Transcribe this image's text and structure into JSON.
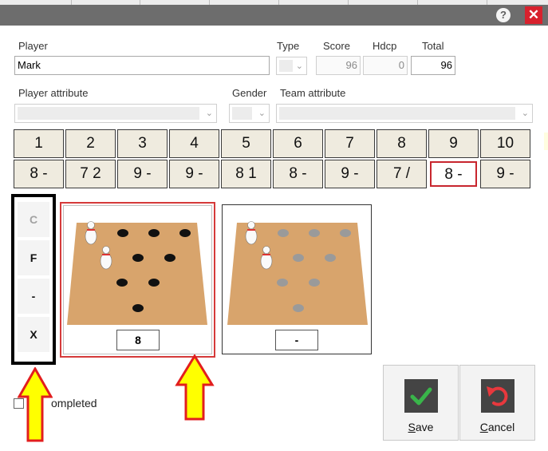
{
  "window": {
    "help_glyph": "?",
    "close_glyph": "✕"
  },
  "form": {
    "player_label": "Player",
    "player_value": "Mark",
    "type_label": "Type",
    "score_label": "Score",
    "score_value": "96",
    "hdcp_label": "Hdcp",
    "hdcp_value": "0",
    "total_label": "Total",
    "total_value": "96",
    "player_attribute_label": "Player attribute",
    "gender_label": "Gender",
    "team_attribute_label": "Team attribute"
  },
  "frames": [
    {
      "number": "1",
      "score": "8 -"
    },
    {
      "number": "2",
      "score": "7 2"
    },
    {
      "number": "3",
      "score": "9 -"
    },
    {
      "number": "4",
      "score": "9 -"
    },
    {
      "number": "5",
      "score": "8 1"
    },
    {
      "number": "6",
      "score": "8 -"
    },
    {
      "number": "7",
      "score": "9 -"
    },
    {
      "number": "8",
      "score": "7 /"
    },
    {
      "number": "9",
      "score": "8 -"
    },
    {
      "number": "10",
      "score": "9 -"
    }
  ],
  "selected_frame_index": 8,
  "left_buttons": [
    {
      "label": "C",
      "enabled": false
    },
    {
      "label": "F",
      "enabled": true
    },
    {
      "label": "-",
      "enabled": true
    },
    {
      "label": "X",
      "enabled": true
    }
  ],
  "roll1": {
    "value": "8",
    "pins_standing": [
      7,
      4
    ]
  },
  "roll2": {
    "value": "-",
    "pins_standing": [
      7,
      4
    ]
  },
  "completed_label": "Completed",
  "completed_visible_text": "ompleted",
  "save_label": "Save",
  "cancel_label": "Cancel",
  "colors": {
    "titlebar": "#6d6d6d",
    "close_bg": "#d8212d",
    "frame_bg": "#efebdf",
    "selected_border": "#c8262e",
    "lane": "#d8a46c",
    "arrow_fill": "#ffff00",
    "arrow_stroke": "#e21e1e",
    "save_check": "#39b54a",
    "cancel_arrow": "#e8383d"
  }
}
